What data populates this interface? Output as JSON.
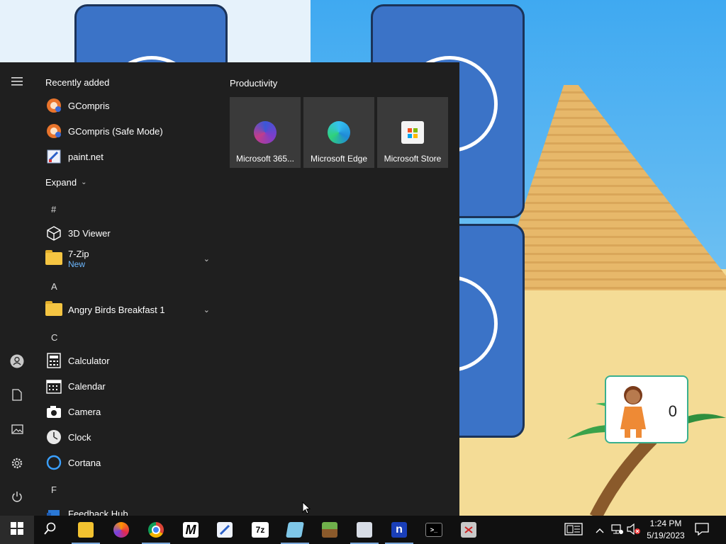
{
  "start_menu": {
    "recently_added_label": "Recently added",
    "recent_apps": [
      {
        "label": "GCompris",
        "icon": "gcompris-icon"
      },
      {
        "label": "GCompris (Safe Mode)",
        "icon": "gcompris-icon"
      },
      {
        "label": "paint.net",
        "icon": "paintnet-icon"
      }
    ],
    "expand_label": "Expand",
    "groups": {
      "hash": "#",
      "a": "A",
      "c": "C",
      "f": "F"
    },
    "apps": {
      "viewer3d": "3D Viewer",
      "sevenzip": "7-Zip",
      "sevenzip_badge": "New",
      "angrybirds": "Angry Birds Breakfast 1",
      "calculator": "Calculator",
      "calendar": "Calendar",
      "camera": "Camera",
      "clock": "Clock",
      "cortana": "Cortana",
      "feedback": "Feedback Hub"
    },
    "productivity_label": "Productivity",
    "tiles": [
      {
        "label": "Microsoft 365...",
        "icon": "microsoft365-icon"
      },
      {
        "label": "Microsoft Edge",
        "icon": "edge-icon"
      },
      {
        "label": "Microsoft Store",
        "icon": "store-icon"
      }
    ]
  },
  "game": {
    "score": "0"
  },
  "taskbar": {
    "apps": [
      "start-icon",
      "search-icon",
      "file-explorer-icon",
      "firefox-icon",
      "chrome-icon",
      "m-app-icon",
      "paintnet-icon",
      "7zip-icon",
      "notepad-icon",
      "minecraft-icon",
      "viewer-icon",
      "n-app-icon",
      "terminal-icon",
      "app-icon"
    ],
    "time": "1:24 PM",
    "date": "5/19/2023"
  },
  "colors": {
    "menu_bg": "#1f1f1f",
    "tile_bg": "#3a3a3a",
    "taskbar_bg": "#101010",
    "accent_link": "#6cb8ff"
  }
}
